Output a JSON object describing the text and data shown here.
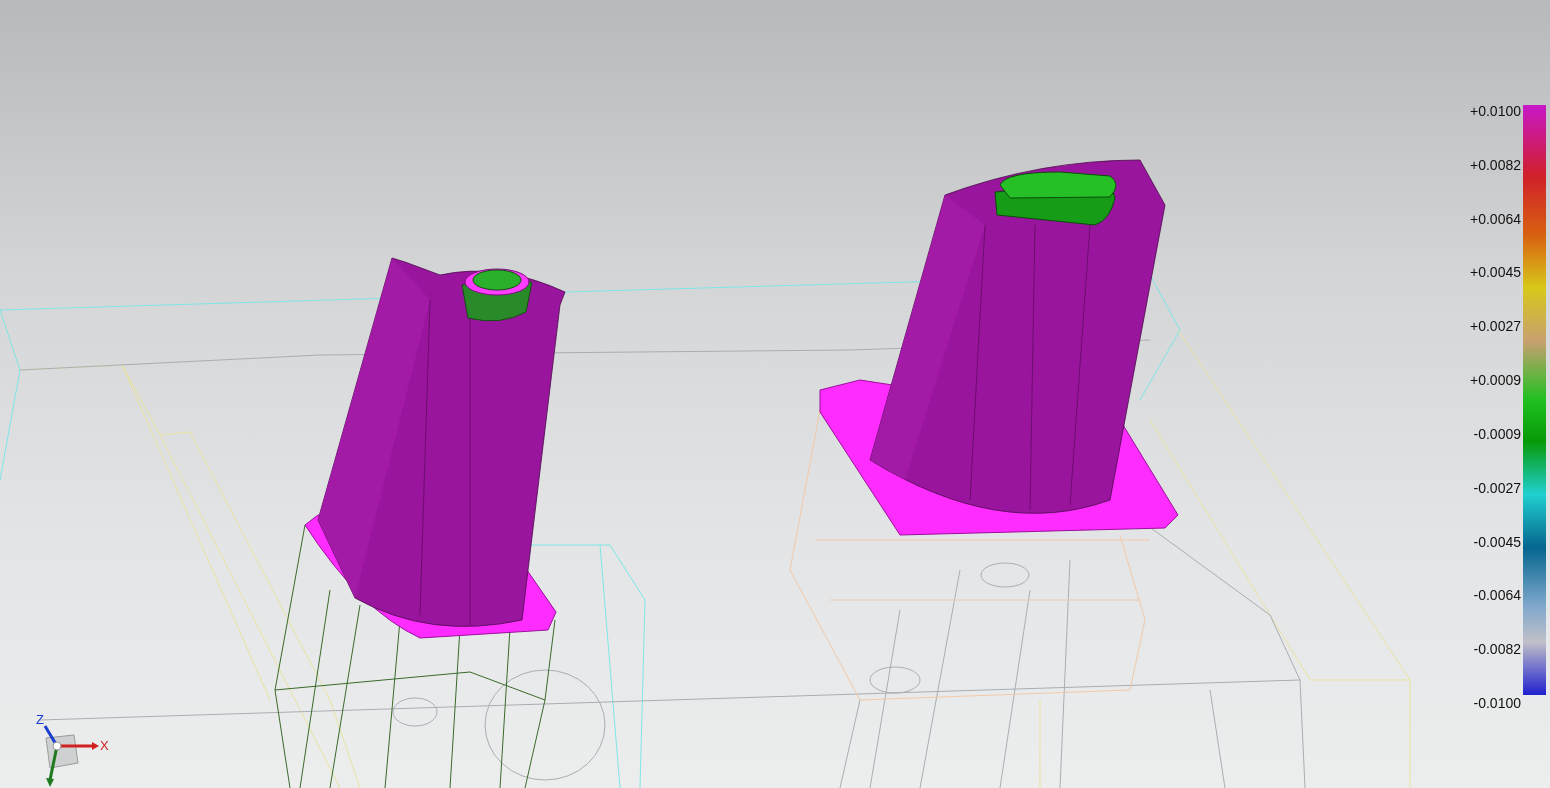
{
  "legend": {
    "labels": [
      "+0.0100",
      "+0.0082",
      "+0.0064",
      "+0.0045",
      "+0.0027",
      "+0.0009",
      "-0.0009",
      "-0.0027",
      "-0.0045",
      "-0.0064",
      "-0.0082",
      "-0.0100"
    ]
  },
  "triad": {
    "z_label": "Z",
    "x_label": "X"
  }
}
